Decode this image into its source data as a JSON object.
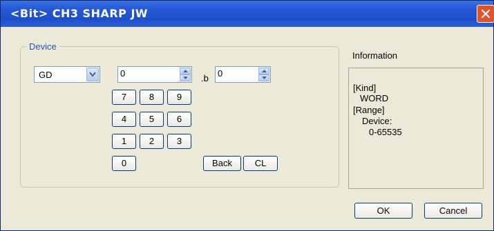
{
  "window": {
    "title": "<Bit> CH3 SHARP JW"
  },
  "device": {
    "group_label": "Device",
    "device_type": "GD",
    "word_value": "0",
    "bit_separator": ".b",
    "bit_value": "0"
  },
  "keypad": {
    "keys": [
      "7",
      "8",
      "9",
      "4",
      "5",
      "6",
      "1",
      "2",
      "3",
      "0"
    ],
    "back_label": "Back",
    "clear_label": "CL"
  },
  "information": {
    "label": "Information",
    "kind_heading": "[Kind]",
    "kind_value": "WORD",
    "range_heading": "[Range]",
    "device_label": "Device:",
    "range_value": "0-65535"
  },
  "buttons": {
    "ok": "OK",
    "cancel": "Cancel"
  },
  "colors": {
    "titlebar": "#2559d6",
    "close": "#e0532c",
    "dialog_bg": "#ece9d8",
    "group_label": "#2253c8"
  }
}
